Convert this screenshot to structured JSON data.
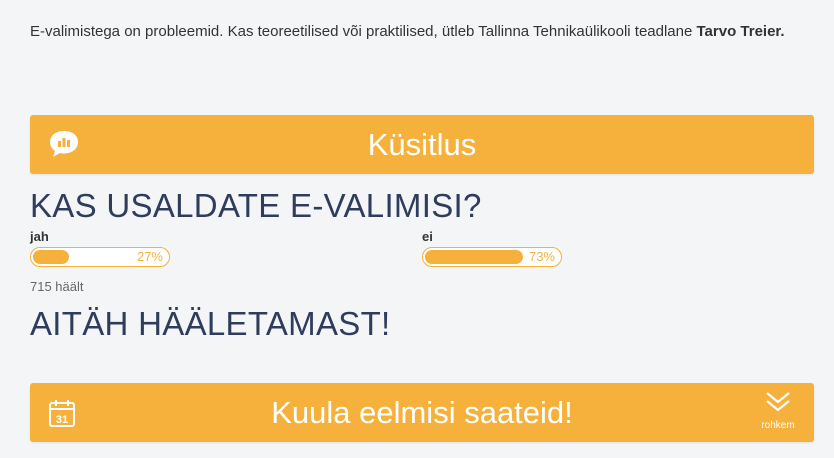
{
  "article": {
    "intro_text": "E-valimistega on probleemid. Kas teoreetilised või praktilised, ütleb Tallinna Tehnikaülikooli teadlane ",
    "intro_author": "Tarvo Treier."
  },
  "poll": {
    "banner_title": "Küsitlus",
    "banner_icon": "chat-bar-chart-icon",
    "question": "KAS USALDATE E-VALIMISI?",
    "options": [
      {
        "label": "jah",
        "percent": 27,
        "percent_text": "27%"
      },
      {
        "label": "ei",
        "percent": 73,
        "percent_text": "73%"
      }
    ],
    "votes_text": "715 häält",
    "thanks_text": "AITÄH HÄÄLETAMAST!"
  },
  "more": {
    "banner_title": "Kuula eelmisi saateid!",
    "banner_icon": "calendar-31-icon",
    "calendar_day": "31",
    "more_label": "rohkem",
    "more_icon": "double-chevron-down-icon"
  },
  "colors": {
    "accent": "#f5b13c",
    "heading": "#2e3d5c",
    "background": "#f4f5f7"
  }
}
